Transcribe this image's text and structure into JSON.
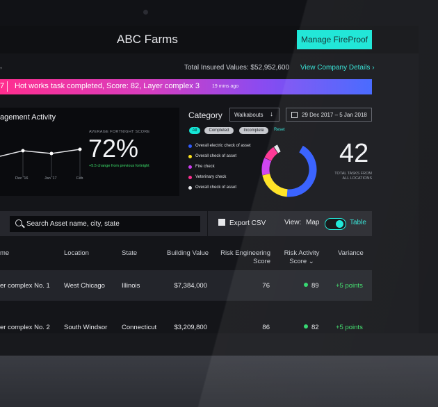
{
  "app": {
    "title": "ABC Farms",
    "manage_button": "Manage FireProof"
  },
  "subheader": {
    "leading": ",",
    "insured_label": "Total Insured Values: $52,952,600",
    "details_link": "View Company Details"
  },
  "banner": {
    "number": "7",
    "message": "Hot works task completed, Score: 82,  Layer complex 3",
    "time_ago": "19 mins ago"
  },
  "engagement": {
    "title": "agement Activity",
    "average_label": "AVERAGE FORTNIGHT SCORE",
    "score": "72%",
    "change": "+5.5 change from previous fortnight",
    "ticks": [
      "Dec '16",
      "Jan '17",
      "Feb"
    ]
  },
  "category": {
    "label": "Category",
    "dropdown": "Walkabouts",
    "date_range": "29 Dec 2017 – 5 Jan 2018",
    "filters": [
      "All",
      "Completed",
      "Incomplete"
    ],
    "reset": "Reset",
    "legend": [
      {
        "label": "Overall electric check of asset",
        "color": "#2f5bff"
      },
      {
        "label": "Overall check of asset",
        "color": "#ffe11a"
      },
      {
        "label": "Fire check",
        "color": "#cc3cf0"
      },
      {
        "label": "Veterinary check",
        "color": "#ff2e8f"
      },
      {
        "label": "Overall check of asset",
        "color": "#e6e7ea"
      }
    ],
    "total": "42",
    "total_label": "TOTAL TASKS FROM ALL LOCATIONS"
  },
  "toolbar": {
    "search_placeholder": "Search Asset name, city, state",
    "export": "Export CSV",
    "view_label": "View:",
    "map_label": "Map",
    "table_label": "Table"
  },
  "table": {
    "headers": [
      "me",
      "Location",
      "State",
      "Building Value",
      "Risk Engineering Score",
      "Risk Activity Score",
      "Variance"
    ],
    "rows": [
      {
        "name": "er complex No. 1",
        "location": "West Chicago",
        "state": "Illinois",
        "value": "$7,384,000",
        "eng": "76",
        "activity": "89",
        "variance": "+5 points"
      },
      {
        "name": "er complex No. 2",
        "location": "South Windsor",
        "state": "Connecticut",
        "value": "$3,209,800",
        "eng": "86",
        "activity": "82",
        "variance": "+5 points"
      }
    ]
  }
}
